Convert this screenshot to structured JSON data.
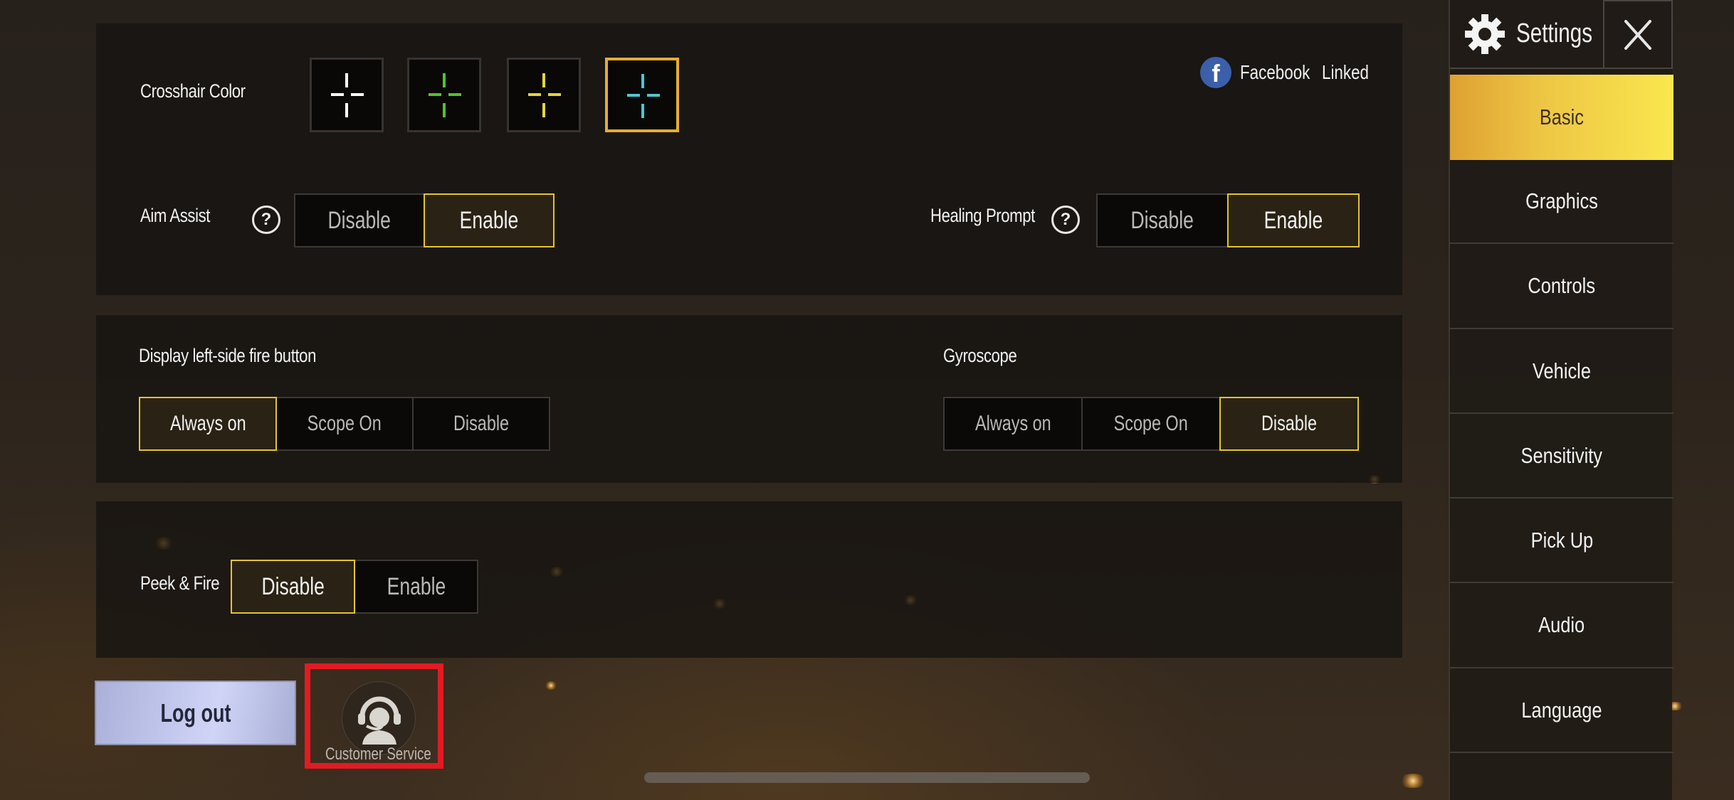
{
  "header": {
    "title": "Settings",
    "gear_icon": "gear-icon",
    "close_icon": "close-icon"
  },
  "sidebar": {
    "active": "Basic",
    "items": [
      {
        "label": "Basic"
      },
      {
        "label": "Graphics"
      },
      {
        "label": "Controls"
      },
      {
        "label": "Vehicle"
      },
      {
        "label": "Sensitivity"
      },
      {
        "label": "Pick Up"
      },
      {
        "label": "Audio"
      },
      {
        "label": "Language"
      }
    ]
  },
  "account": {
    "provider": "Facebook",
    "status": "Linked",
    "icon": "facebook-icon",
    "color": "#3b5fa8"
  },
  "crosshair": {
    "label": "Crosshair Color",
    "options": [
      {
        "name": "white",
        "color": "#ffffff",
        "selected": false
      },
      {
        "name": "green",
        "color": "#56c22c",
        "selected": false
      },
      {
        "name": "yellow",
        "color": "#e3d636",
        "selected": false
      },
      {
        "name": "cyan",
        "color": "#4fc7cf",
        "selected": true
      }
    ]
  },
  "aim_assist": {
    "label": "Aim Assist",
    "options": [
      "Disable",
      "Enable"
    ],
    "selected": "Enable"
  },
  "healing_prompt": {
    "label": "Healing Prompt",
    "options": [
      "Disable",
      "Enable"
    ],
    "selected": "Enable"
  },
  "left_fire": {
    "label": "Display left-side fire button",
    "options": [
      "Always on",
      "Scope On",
      "Disable"
    ],
    "selected": "Always on"
  },
  "gyroscope": {
    "label": "Gyroscope",
    "options": [
      "Always on",
      "Scope On",
      "Disable"
    ],
    "selected": "Disable"
  },
  "peek_fire": {
    "label": "Peek & Fire",
    "options": [
      "Disable",
      "Enable"
    ],
    "selected": "Disable"
  },
  "footer": {
    "logout_label": "Log out",
    "customer_service_label": "Customer Service",
    "customer_service_icon": "headset-agent-icon"
  },
  "colors": {
    "selected_border": "#e3c42e",
    "active_tab_start": "#dea132",
    "active_tab_end": "#fae74e",
    "highlight_box": "#e21b23"
  }
}
